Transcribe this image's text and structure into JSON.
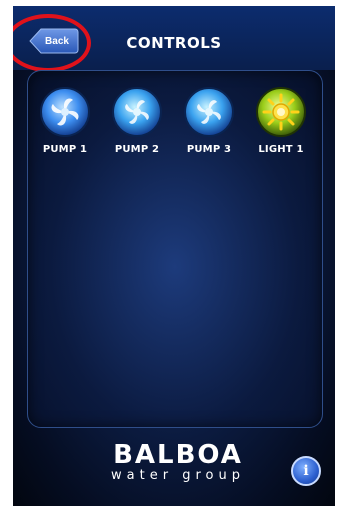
{
  "header": {
    "back_label": "Back",
    "title": "CONTROLS"
  },
  "controls": [
    {
      "label": "PUMP 1",
      "icon": "pump-icon",
      "color": "#1f6fd6"
    },
    {
      "label": "PUMP 2",
      "icon": "pump-icon",
      "color": "#1f6fd6"
    },
    {
      "label": "PUMP 3",
      "icon": "pump-icon",
      "color": "#1f6fd6"
    },
    {
      "label": "LIGHT 1",
      "icon": "light-icon",
      "color": "#9acd1a"
    }
  ],
  "footer": {
    "brand_name": "BALBOA",
    "brand_subtitle": "water group",
    "info_label": "i"
  },
  "colors": {
    "highlight_ring": "#e0121b",
    "background": "#0d1f48",
    "pump_active": "#1f6fd6",
    "light_active": "#9acd1a"
  }
}
